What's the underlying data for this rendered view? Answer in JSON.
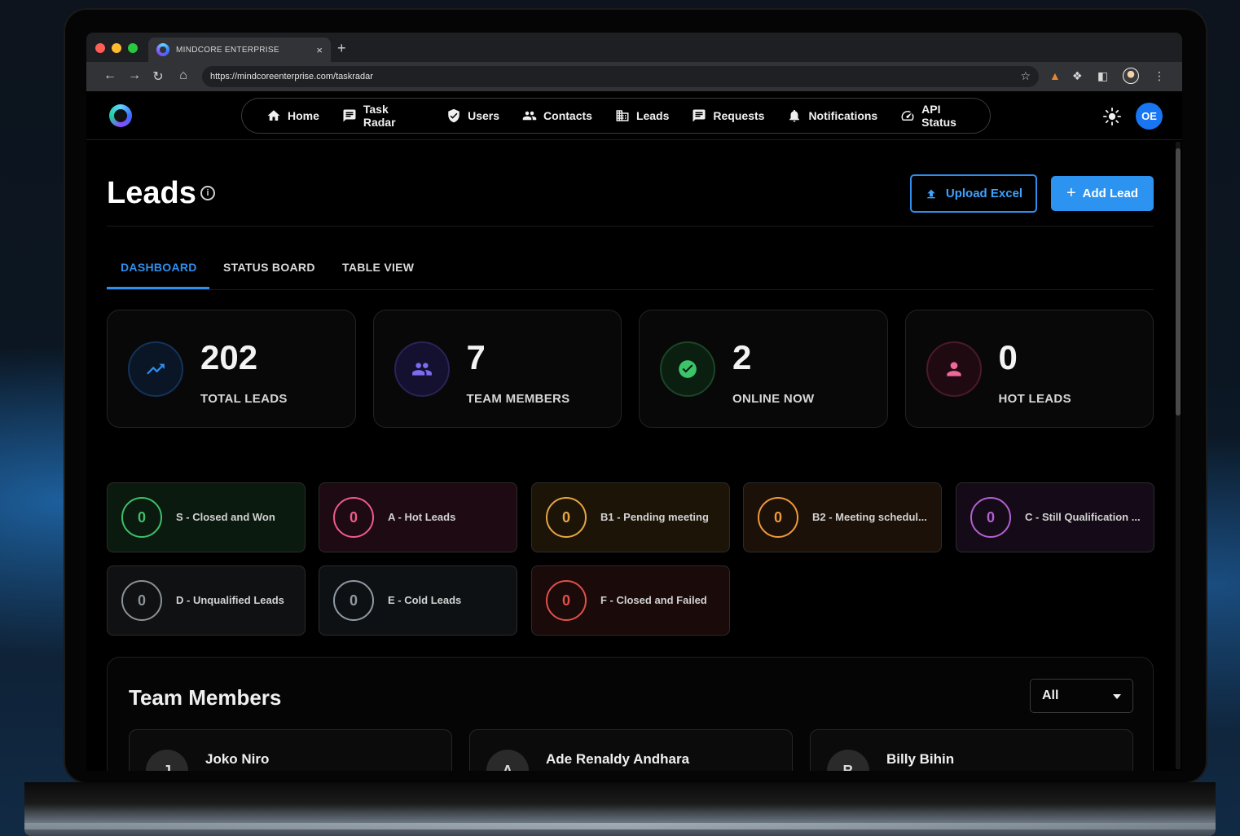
{
  "browser": {
    "tab_title": "MINDCORE ENTERPRISE",
    "tab_close": "×",
    "new_tab": "+",
    "url": "https://mindcoreenterprise.com/taskradar"
  },
  "nav": {
    "items": [
      {
        "label": "Home",
        "icon": "home-icon"
      },
      {
        "label": "Task Radar",
        "icon": "chat-icon"
      },
      {
        "label": "Users",
        "icon": "shield-check-icon"
      },
      {
        "label": "Contacts",
        "icon": "people-icon"
      },
      {
        "label": "Leads",
        "icon": "building-icon"
      },
      {
        "label": "Requests",
        "icon": "message-icon"
      },
      {
        "label": "Notifications",
        "icon": "bell-icon"
      },
      {
        "label": "API Status",
        "icon": "speedometer-icon"
      }
    ],
    "avatar_initials": "OE"
  },
  "page": {
    "title": "Leads",
    "info": "i",
    "upload_label": "Upload Excel",
    "add_label": "Add Lead",
    "add_icon": "+"
  },
  "tabs": [
    "DASHBOARD",
    "STATUS BOARD",
    "TABLE VIEW"
  ],
  "stats": [
    {
      "value": "202",
      "label": "TOTAL LEADS",
      "icon": "trending-up-icon",
      "color": "#2f8ff0"
    },
    {
      "value": "7",
      "label": "TEAM MEMBERS",
      "icon": "group-icon",
      "color": "#7b6cf0"
    },
    {
      "value": "2",
      "label": "ONLINE NOW",
      "icon": "check-circle-icon",
      "color": "#3cc46a"
    },
    {
      "value": "0",
      "label": "HOT LEADS",
      "icon": "person-icon",
      "color": "#f0679a"
    }
  ],
  "statuses": [
    {
      "count": "0",
      "label": "S - Closed and Won",
      "color": "#3fbf6a",
      "bg": "#0b1a0e"
    },
    {
      "count": "0",
      "label": "A - Hot Leads",
      "color": "#ef5b8a",
      "bg": "#1d0a12"
    },
    {
      "count": "0",
      "label": "B1 - Pending meeting",
      "color": "#e6a545",
      "bg": "#1d1408"
    },
    {
      "count": "0",
      "label": "B2 - Meeting schedul...",
      "color": "#ee9a3a",
      "bg": "#1c1108"
    },
    {
      "count": "0",
      "label": "C - Still Qualification ...",
      "color": "#b460d0",
      "bg": "#150b18"
    },
    {
      "count": "0",
      "label": "D - Unqualified Leads",
      "color": "#8a9198",
      "bg": "#0f1112"
    },
    {
      "count": "0",
      "label": "E - Cold Leads",
      "color": "#8f9aa3",
      "bg": "#0e1113"
    },
    {
      "count": "0",
      "label": "F - Closed and Failed",
      "color": "#e0504a",
      "bg": "#1a0a09"
    }
  ],
  "team": {
    "title": "Team Members",
    "filter_value": "All",
    "members": [
      {
        "name": "Joko Niro",
        "initial": "J"
      },
      {
        "name": "Ade Renaldy Andhara",
        "initial": "A"
      },
      {
        "name": "Billy Bihin",
        "initial": "B"
      }
    ]
  }
}
